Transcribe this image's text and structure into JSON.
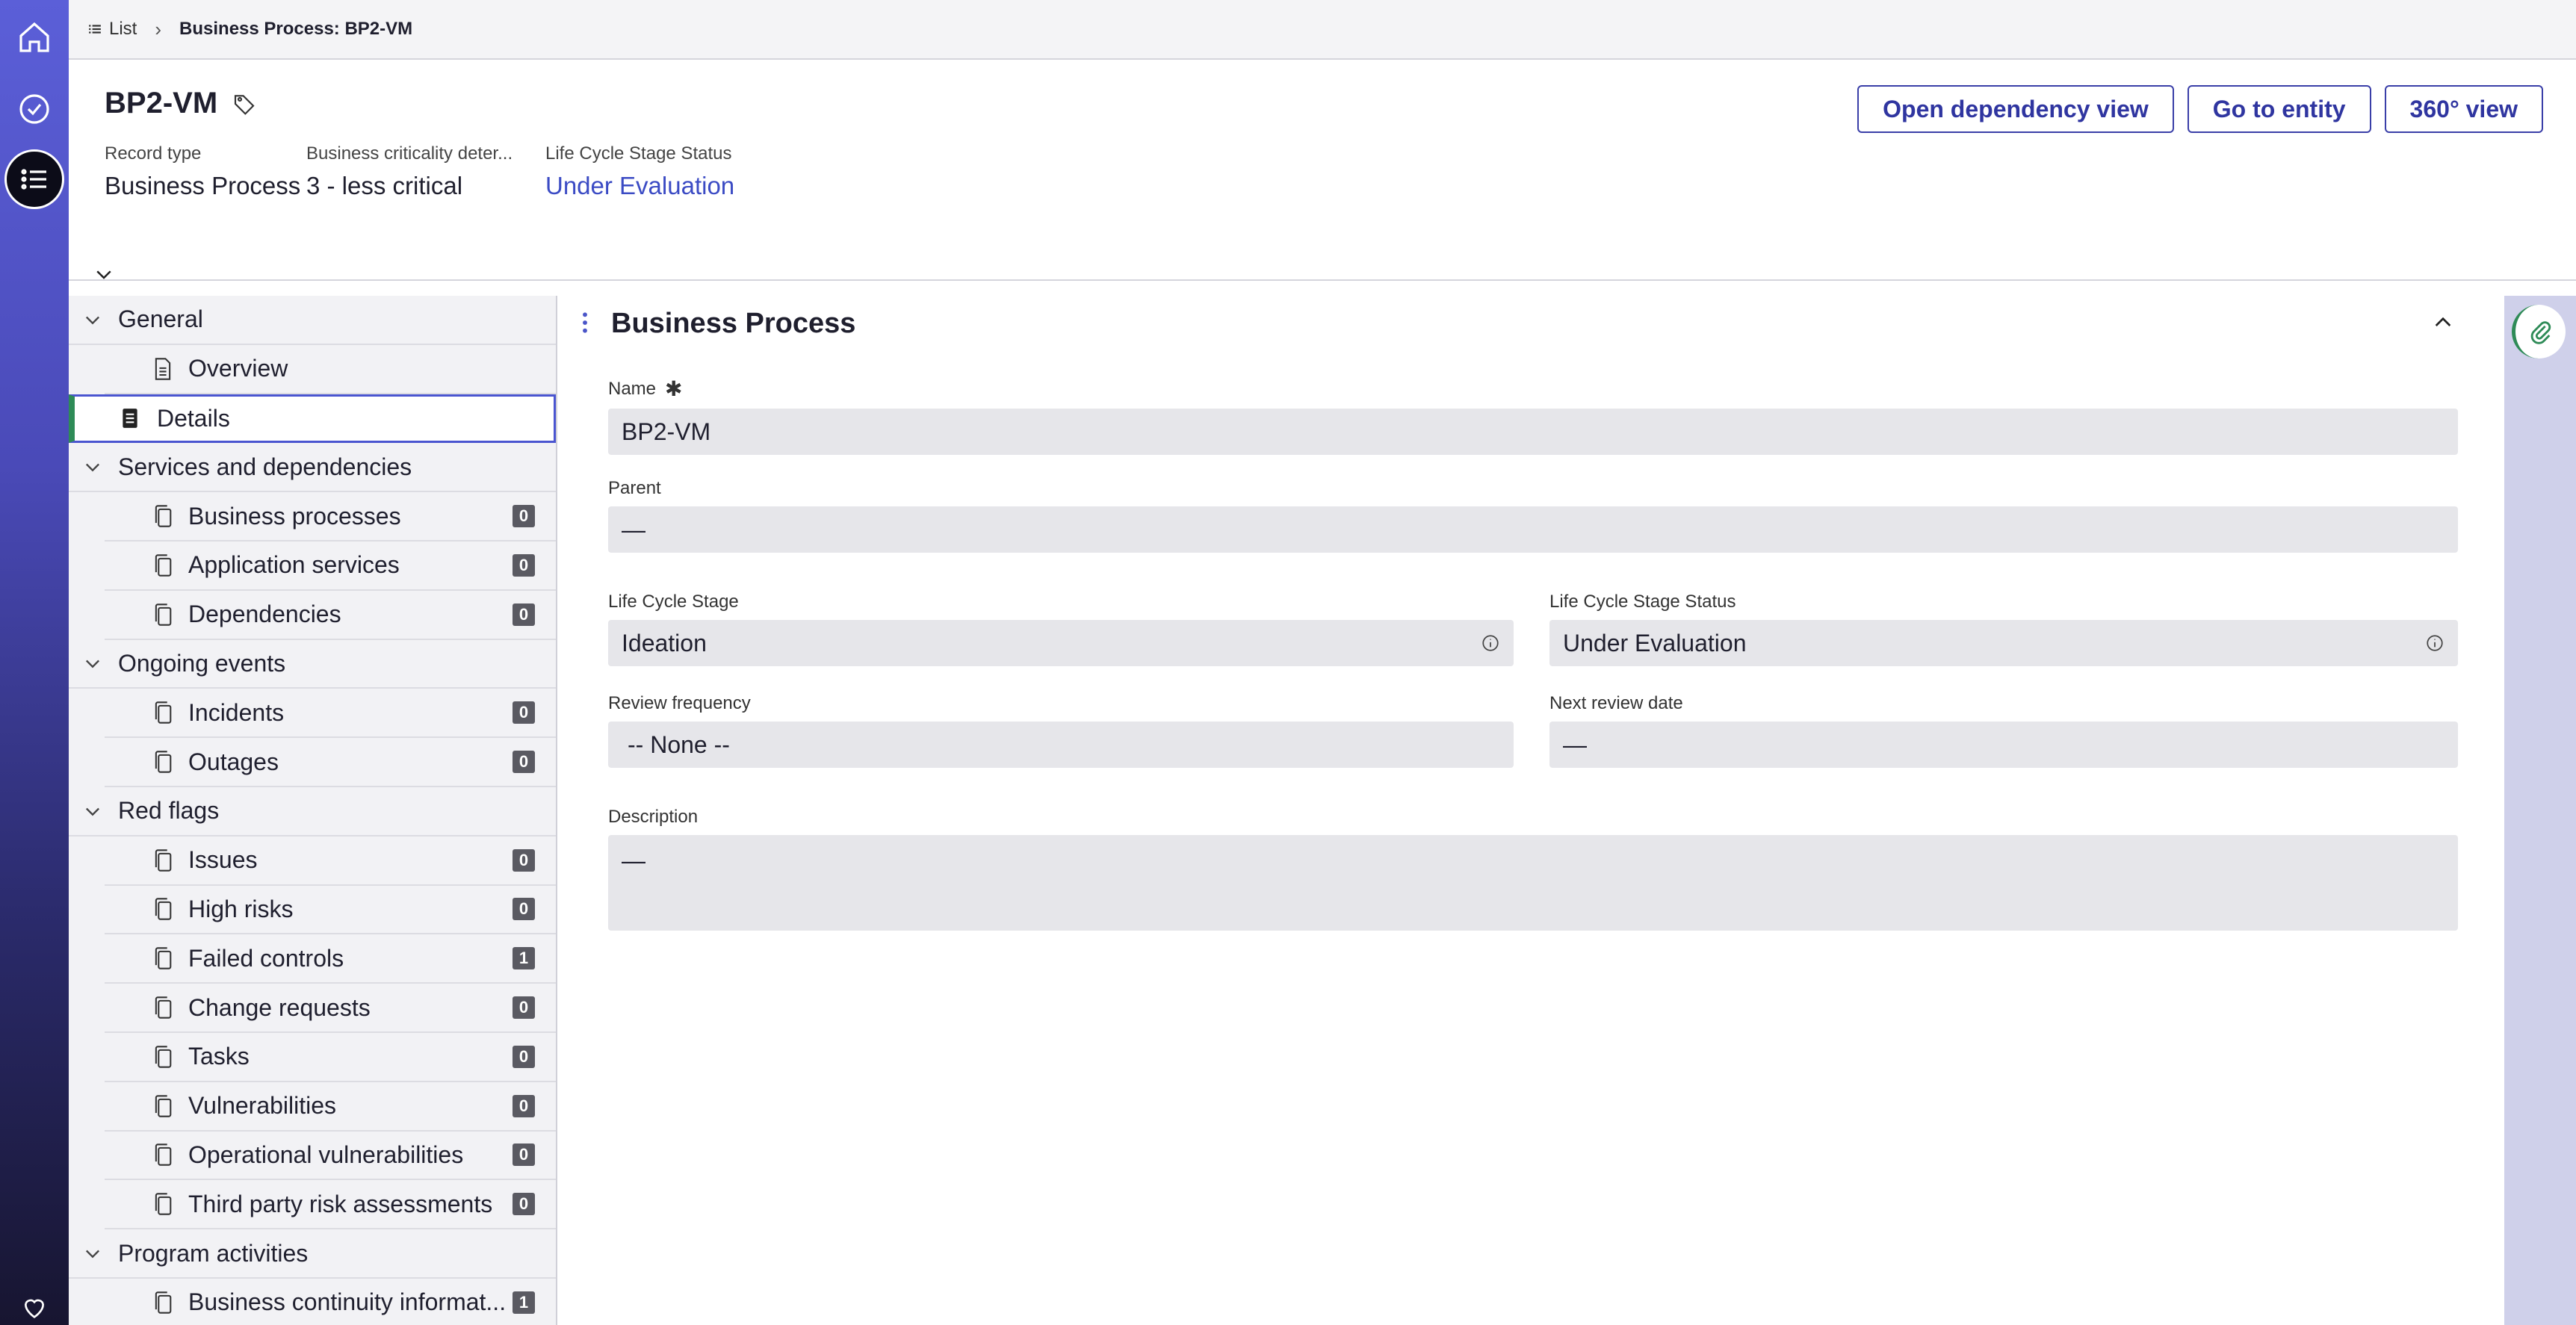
{
  "breadcrumb": {
    "list_label": "List",
    "current": "Business Process: BP2-VM"
  },
  "header": {
    "title": "BP2-VM",
    "meta": [
      {
        "label": "Record type",
        "value": "Business Process"
      },
      {
        "label": "Business criticality deter...",
        "value": "3 - less critical"
      },
      {
        "label": "Life Cycle Stage Status",
        "value": "Under Evaluation"
      }
    ],
    "buttons": {
      "dependency": "Open dependency view",
      "entity": "Go to entity",
      "view360": "360° view"
    }
  },
  "nav": {
    "general": "General",
    "overview": "Overview",
    "details": "Details",
    "services": "Services and dependencies",
    "business_processes": {
      "label": "Business processes",
      "count": "0"
    },
    "application_services": {
      "label": "Application services",
      "count": "0"
    },
    "dependencies": {
      "label": "Dependencies",
      "count": "0"
    },
    "ongoing": "Ongoing events",
    "incidents": {
      "label": "Incidents",
      "count": "0"
    },
    "outages": {
      "label": "Outages",
      "count": "0"
    },
    "redflags": "Red flags",
    "issues": {
      "label": "Issues",
      "count": "0"
    },
    "high_risks": {
      "label": "High risks",
      "count": "0"
    },
    "failed_controls": {
      "label": "Failed controls",
      "count": "1"
    },
    "change_requests": {
      "label": "Change requests",
      "count": "0"
    },
    "tasks": {
      "label": "Tasks",
      "count": "0"
    },
    "vulnerabilities": {
      "label": "Vulnerabilities",
      "count": "0"
    },
    "op_vulnerabilities": {
      "label": "Operational vulnerabilities",
      "count": "0"
    },
    "third_party": {
      "label": "Third party risk assessments",
      "count": "0"
    },
    "program": "Program activities",
    "bc_info": {
      "label": "Business continuity informat...",
      "count": "1"
    }
  },
  "form": {
    "section_title": "Business Process",
    "name": {
      "label": "Name",
      "value": "BP2-VM"
    },
    "parent": {
      "label": "Parent",
      "value": "—"
    },
    "lcs": {
      "label": "Life Cycle Stage",
      "value": "Ideation"
    },
    "lcs_status": {
      "label": "Life Cycle Stage Status",
      "value": "Under Evaluation"
    },
    "review_freq": {
      "label": "Review frequency",
      "value": "-- None --"
    },
    "next_review": {
      "label": "Next review date",
      "value": "—"
    },
    "description": {
      "label": "Description",
      "value": "—"
    }
  }
}
